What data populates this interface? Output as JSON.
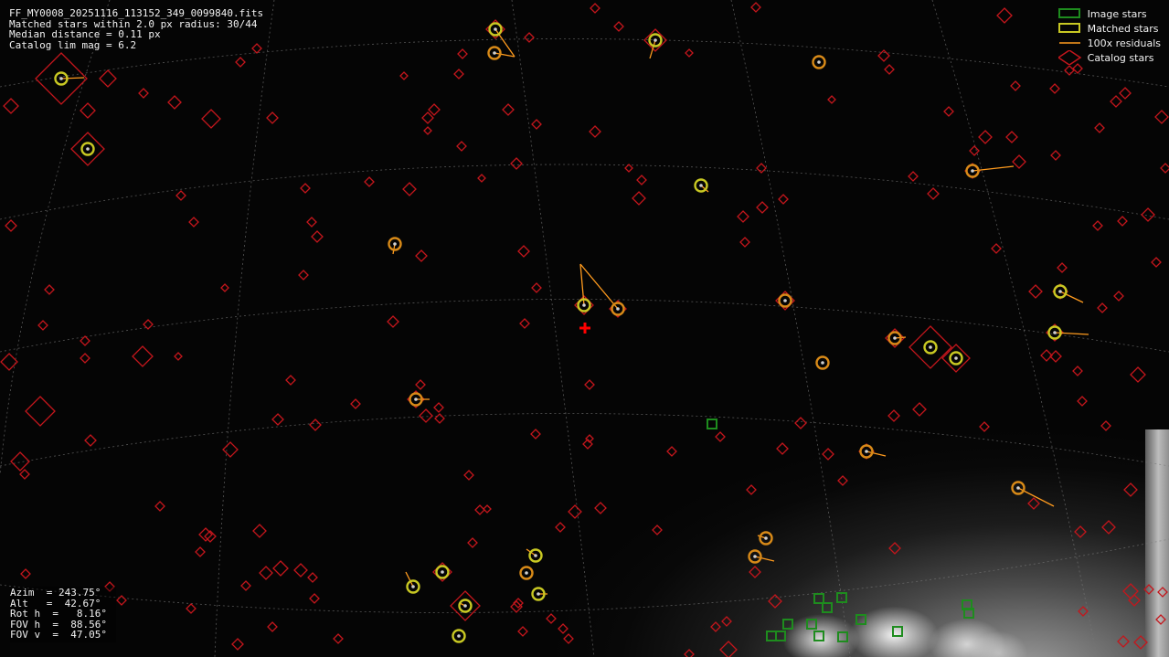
{
  "header": {
    "filename": "FF_MY0008_20251116_113152_349_0099840.fits",
    "matched_line": "Matched stars within 2.0 px radius: 30/44",
    "median_line": "Median distance = 0.11 px",
    "catalog_line": "Catalog lim mag = 6.2"
  },
  "legend": {
    "image_stars": "Image stars",
    "matched_stars": "Matched stars",
    "residuals": "100x residuals",
    "catalog_stars": "Catalog stars"
  },
  "params": {
    "azim": "Azim  = 243.75°",
    "alt": "Alt   =  42.67°",
    "rot": "Rot h  =   8.16°",
    "fovh": "FOV h  =  88.56°",
    "fovv": "FOV v  =  47.05°"
  },
  "colors": {
    "catalog": "#c4161c",
    "matched_ring": "#c8c823",
    "image_star": "#1e8c1e",
    "residual": "#ff9b1e",
    "center_marker": "#ff0000",
    "grid": "#777777"
  }
}
